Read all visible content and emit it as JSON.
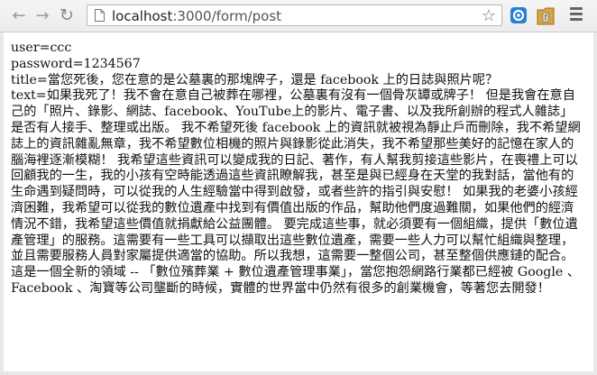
{
  "browser": {
    "url_host": "localhost",
    "url_path": ":3000/form/post",
    "back_icon": "arrow-left",
    "forward_icon": "arrow-right",
    "reload_icon": "reload",
    "star_icon": "star",
    "menu_icon": "hamburger"
  },
  "form_post": {
    "user_line": "user=ccc",
    "password_line": "password=1234567",
    "title_line": "title=當您死後，您在意的是公墓裏的那塊牌子，還是 facebook 上的日誌與照片呢？",
    "text_line": "text=如果我死了！我不會在意自己被葬在哪裡，公墓裏有沒有一個骨灰罈或牌子！ 但是我會在意自己的「照片、錄影、網誌、facebook、YouTube上的影片、電子書、以及我所創辦的程式人雜誌」是否有人接手、整理或出版。 我不希望死後 facebook 上的資訊就被視為靜止戶而刪除，我不希望網誌上的資訊雜亂無章，我不希望數位相機的照片與錄影從此消失，我不希望那些美好的記憶在家人的腦海裡逐漸模糊！ 我希望這些資訊可以變成我的日記、著作，有人幫我剪接這些影片，在喪禮上可以回顧我的一生，我的小孩有空時能透過這些資訊瞭解我，甚至是與已經身在天堂的我對話，當他有的生命遇到疑問時，可以從我的人生經驗當中得到啟發，或者些許的指引與安慰！ 如果我的老婆小孩經濟困難，我希望可以從我的數位遺產中找到有價值出版的作品，幫助他們度過難關，如果他們的經濟情況不錯，我希望這些價值就捐獻給公益團體。 要完成這些事，就必須要有一個組織，提供「數位遺產管理」的服務。這需要有一些工具可以擷取出這些數位遺產，需要一些人力可以幫忙組織與整理，並且需要服務人員對家屬提供適當的協助。所以我想，這需要一整個公司，甚至整個供應鏈的配合。 這是一個全新的領域 -- 「數位殯葬業 + 數位遺產管理事業」，當您抱怨網路行業都已經被 Google 、Facebook 、淘寶等公司壟斷的時候，實體的世界當中仍然有很多的創業機會，等著您去開發！"
  }
}
